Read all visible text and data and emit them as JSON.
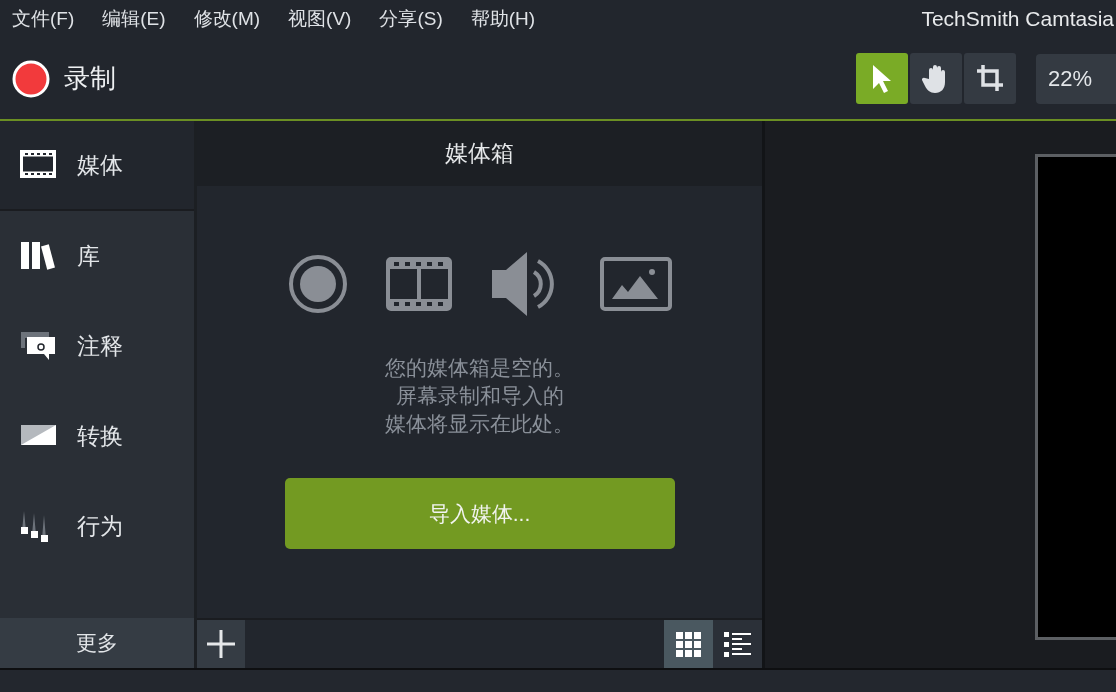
{
  "menu": [
    "文件(F)",
    "编辑(E)",
    "修改(M)",
    "视图(V)",
    "分享(S)",
    "帮助(H)"
  ],
  "app_title": "TechSmith Camtasia",
  "record_button": {
    "label": "录制"
  },
  "tools": [
    {
      "kind": "select",
      "selected": true
    },
    {
      "kind": "hand",
      "selected": false
    },
    {
      "kind": "crop",
      "selected": false
    }
  ],
  "zoom": "22%",
  "sidebar": {
    "items": [
      {
        "kind": "media",
        "label": "媒体",
        "selected": true
      },
      {
        "kind": "library",
        "label": "库",
        "selected": false
      },
      {
        "kind": "annotations",
        "label": "注释",
        "selected": false
      },
      {
        "kind": "transitions",
        "label": "转换",
        "selected": false
      },
      {
        "kind": "behaviors",
        "label": "行为",
        "selected": false
      }
    ],
    "more": "更多"
  },
  "media_bin": {
    "title": "媒体箱",
    "empty_message": [
      "您的媒体箱是空的。",
      "屏幕录制和导入的",
      "媒体将显示在此处。"
    ],
    "import_button": "导入媒体...",
    "views": [
      {
        "kind": "grid",
        "selected": true
      },
      {
        "kind": "list",
        "selected": false
      }
    ]
  }
}
